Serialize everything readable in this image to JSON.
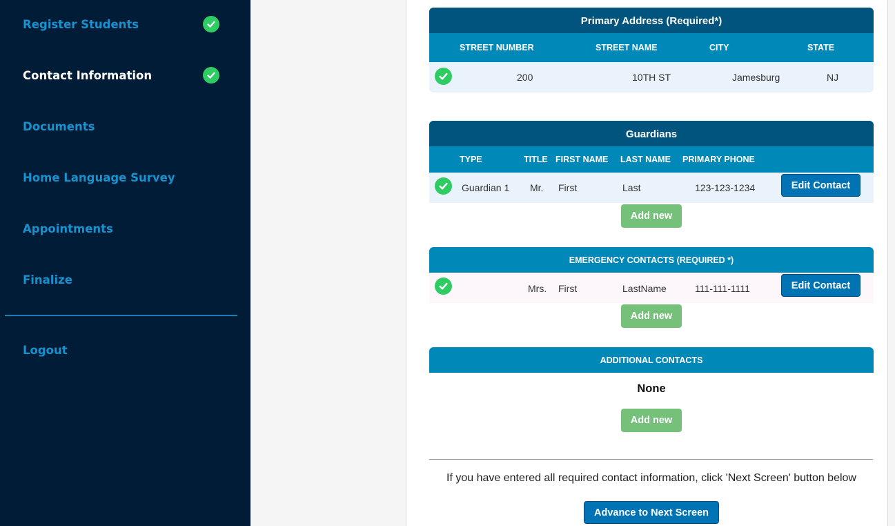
{
  "sidebar": {
    "items": [
      {
        "label": "Register Students",
        "complete": true
      },
      {
        "label": "Contact Information",
        "complete": true,
        "active": true
      },
      {
        "label": "Documents",
        "complete": false
      },
      {
        "label": "Home Language Survey",
        "complete": false
      },
      {
        "label": "Appointments",
        "complete": false
      },
      {
        "label": "Finalize",
        "complete": false
      }
    ],
    "logout_label": "Logout"
  },
  "address": {
    "title": "Primary Address (Required*)",
    "columns": [
      "STREET NUMBER",
      "STREET NAME",
      "CITY",
      "STATE"
    ],
    "row": {
      "street_number": "200",
      "street_name": "10TH ST",
      "city": "Jamesburg",
      "state": "NJ"
    }
  },
  "guardians": {
    "title": "Guardians",
    "columns": [
      "TYPE",
      "TITLE",
      "FIRST NAME",
      "LAST NAME",
      "PRIMARY PHONE"
    ],
    "rows": [
      {
        "type": "Guardian 1",
        "title": "Mr.",
        "first_name": "First",
        "last_name": "Last",
        "phone": "123-123-1234",
        "action": "Edit Contact"
      }
    ],
    "add_label": "Add new"
  },
  "emergency": {
    "title": "EMERGENCY CONTACTS (REQUIRED *)",
    "rows": [
      {
        "title": "Mrs.",
        "first_name": "First",
        "last_name": "LastName",
        "phone": "111-111-1111",
        "action": "Edit Contact"
      }
    ],
    "add_label": "Add new"
  },
  "additional": {
    "title": "ADDITIONAL CONTACTS",
    "empty_text": "None",
    "add_label": "Add new"
  },
  "footer": {
    "note": "If you have entered all required contact information, click 'Next Screen' button below",
    "next_label": "Advance to Next Screen"
  },
  "colors": {
    "sidebar_bg": "#001c36",
    "nav_link": "#1891cf",
    "header_dark": "#00547d",
    "header_light": "#0088b9",
    "success": "#2ecc63",
    "primary_button": "#0073b5",
    "add_button": "#76c17a"
  }
}
